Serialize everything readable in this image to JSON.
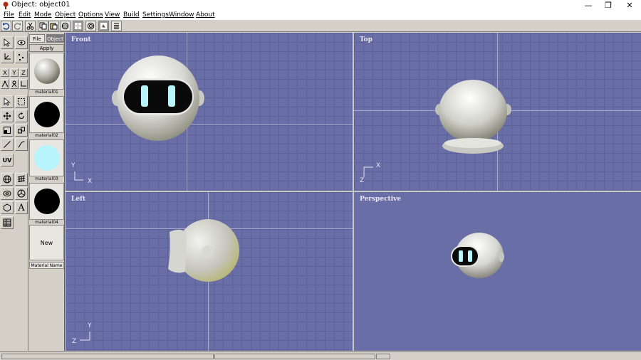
{
  "window": {
    "title": "Object: object01",
    "controls": {
      "minimize": "—",
      "restore": "❐",
      "close": "✕"
    }
  },
  "menu": [
    "File",
    "Edit",
    "Mode",
    "Object",
    "Options",
    "View",
    "Build",
    "Settings",
    "Window",
    "About"
  ],
  "materials": {
    "tabs": [
      "File",
      "Object"
    ],
    "apply_label": "Apply",
    "slots": [
      {
        "label": "material01",
        "color": "#bdbdb6",
        "kind": "shaded"
      },
      {
        "label": "material02",
        "color": "#000000",
        "kind": "solid"
      },
      {
        "label": "material03",
        "color": "#b8f4fb",
        "kind": "solid"
      },
      {
        "label": "material04",
        "color": "#000000",
        "kind": "solid"
      }
    ],
    "new_label": "New",
    "name_label": "Material Name"
  },
  "toolpalette": {
    "axis_buttons": [
      "X",
      "Y",
      "Z"
    ],
    "uv_label": "UV",
    "text_tool": "A"
  },
  "viewports": {
    "front": {
      "label": "Front",
      "axis_up": "Y",
      "axis_right": "X"
    },
    "top": {
      "label": "Top",
      "axis_up": "Z",
      "axis_right": "X"
    },
    "left": {
      "label": "Left",
      "axis_up": "Y",
      "axis_right": "Z"
    },
    "perspective": {
      "label": "Perspective"
    }
  },
  "colors": {
    "viewport_bg": "#6a6ea6",
    "grid": "#5d619a",
    "axis": "#a9abcf",
    "chrome": "#d4d0c8"
  }
}
